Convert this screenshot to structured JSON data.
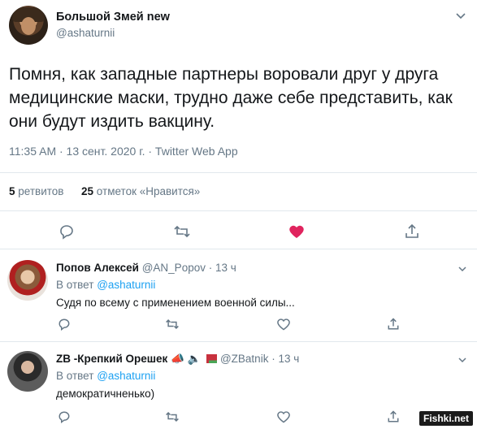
{
  "main_tweet": {
    "author_name": "Большой Змей new",
    "author_handle": "@ashaturnii",
    "text": "Помня, как западные партнеры воровали друг у друга медицинские маски, трудно даже себе представить, как они будут   издить вакцину.",
    "meta": "11:35 AM · 13 сент. 2020 г. · Twitter Web App",
    "retweets_count": "5",
    "retweets_label": "ретвитов",
    "likes_count": "25",
    "likes_label": "отметок «Нравится»",
    "liked": true,
    "like_color": "#e0245e"
  },
  "replies": [
    {
      "author_name": "Попов Алексей",
      "author_handle": "@AN_Popov",
      "time": "13 ч",
      "reply_to_prefix": "В ответ",
      "reply_to_mention": "@ashaturnii",
      "text": "Судя по всему с применением военной силы..."
    },
    {
      "author_name": "ZB -Крепкий Орешек",
      "author_emojis": [
        "megaphone-icon",
        "speaker-icon",
        "belarus-flag-icon"
      ],
      "author_handle": "@ZBatnik",
      "time": "13 ч",
      "reply_to_prefix": "В ответ",
      "reply_to_mention": "@ashaturnii",
      "text": "демократичненько)"
    }
  ],
  "watermark": "Fishki.net",
  "colors": {
    "accent": "#1da1f2",
    "secondary_text": "#657786",
    "divider": "#e1e8ed"
  }
}
